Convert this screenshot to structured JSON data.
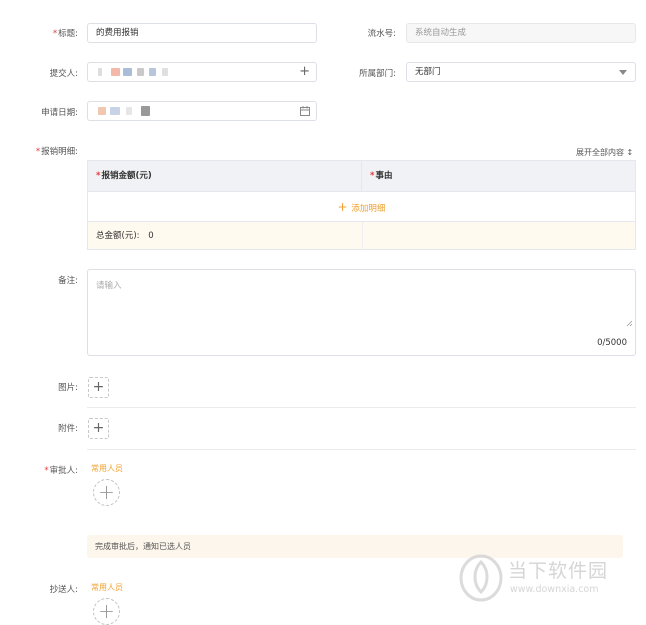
{
  "form": {
    "title": {
      "label": "标题:",
      "value": "的费用报销"
    },
    "serial": {
      "label": "流水号:",
      "placeholder": "系统自动生成"
    },
    "submitter": {
      "label": "提交人:"
    },
    "department": {
      "label": "所属部门:",
      "value": "无部门"
    },
    "apply_date": {
      "label": "申请日期:"
    },
    "details": {
      "label": "报销明细:",
      "expand_link": "展开全部内容 ↕",
      "columns": [
        "报销金额(元)",
        "事由"
      ],
      "add_label": "添加明细",
      "total_label": "总金额(元):",
      "total_value": "0"
    },
    "remark": {
      "label": "备注:",
      "placeholder": "请输入",
      "counter": "0/5000"
    },
    "image": {
      "label": "图片:"
    },
    "attachment": {
      "label": "附件:"
    },
    "approver": {
      "label": "审批人:",
      "common_label": "常用人员"
    },
    "notice": "完成审批后，通知已选人员",
    "cc": {
      "label": "抄送人:",
      "common_label": "常用人员"
    }
  },
  "watermark": {
    "brand": "当下软件园",
    "url": "www.downxia.com"
  },
  "colors": {
    "accent": "#f0a030",
    "required": "#e4393c",
    "table_header": "#f0f2f5",
    "total_row": "#fffaf0"
  }
}
